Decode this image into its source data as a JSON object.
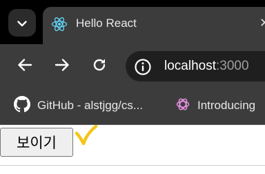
{
  "tab": {
    "title": "Hello React",
    "favicon": "react-logo-icon",
    "close_glyph": "✕"
  },
  "toolbar": {
    "back": "back-arrow-icon",
    "forward": "forward-arrow-icon",
    "reload": "reload-icon",
    "url_host": "localhost",
    "url_port": ":3000"
  },
  "bookmarks": [
    {
      "label": "GitHub - alstjgg/cs...",
      "icon": "github-icon"
    },
    {
      "label": "Introducing",
      "icon": "openai-icon"
    }
  ],
  "page": {
    "button_label": "보이기",
    "annotation": "yellow-checkmark"
  },
  "colors": {
    "tabstrip": "#000000",
    "chrome": "#3c3c3c",
    "omnibox": "#1f1f1f",
    "react": "#61dafb",
    "checkmark": "#f5c518"
  }
}
